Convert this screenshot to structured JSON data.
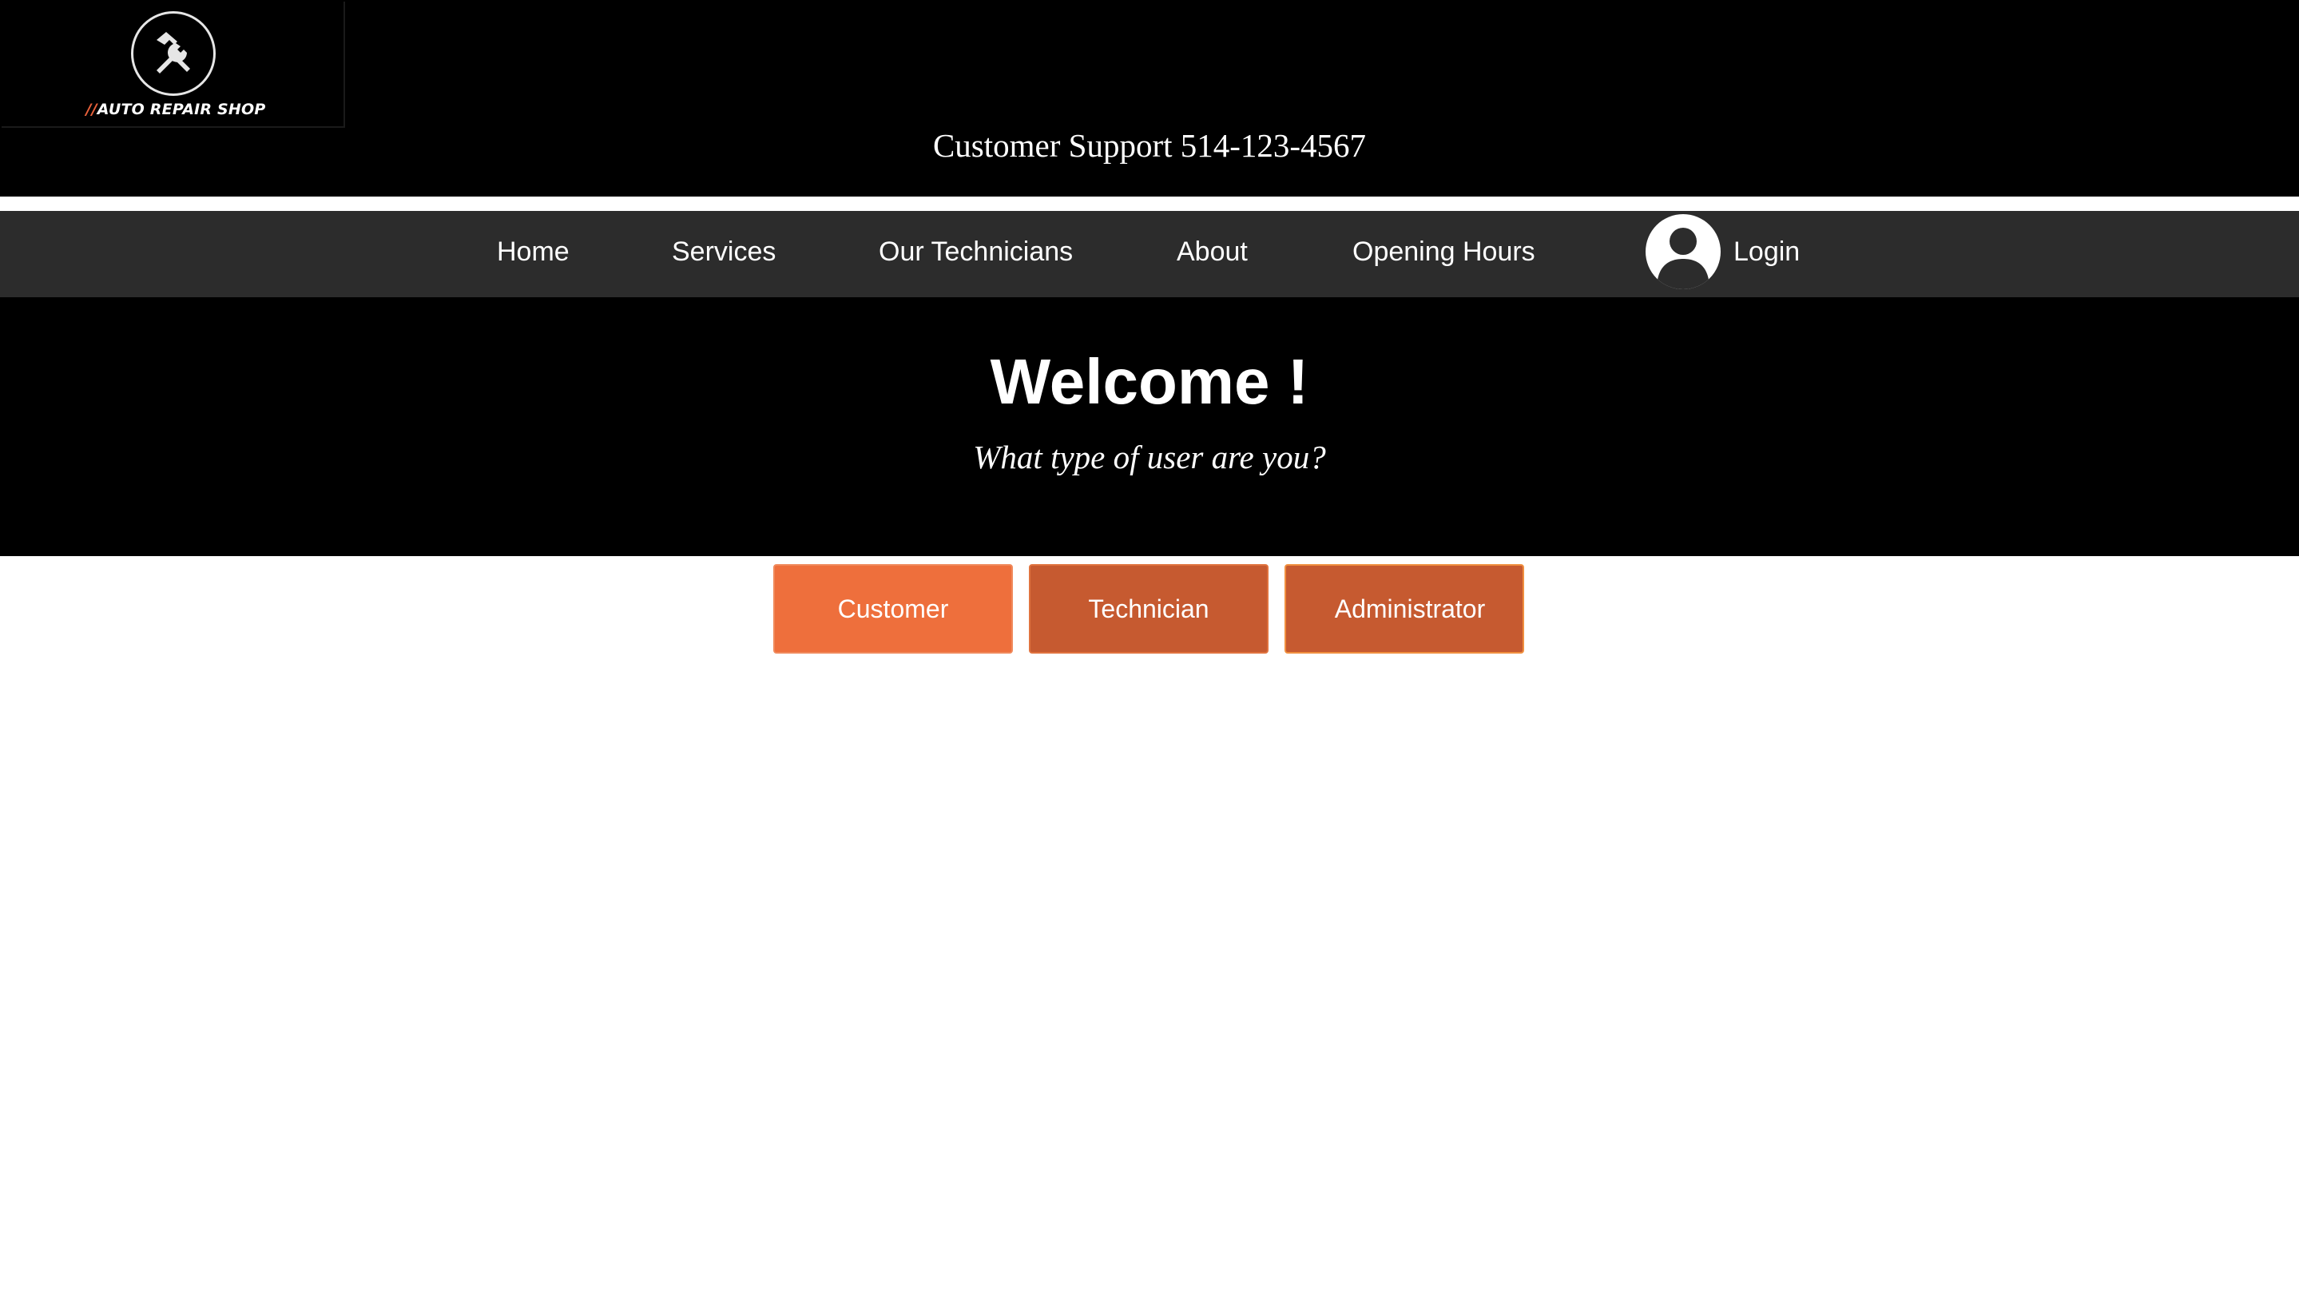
{
  "header": {
    "logo_text_prefix": "//",
    "logo_text": "AUTO REPAIR SHOP",
    "support_text": "Customer Support 514-123-4567"
  },
  "nav": {
    "items": [
      {
        "label": "Home"
      },
      {
        "label": "Services"
      },
      {
        "label": "Our Technicians"
      },
      {
        "label": "About"
      },
      {
        "label": "Opening Hours"
      }
    ],
    "login_label": "Login"
  },
  "hero": {
    "title": "Welcome !",
    "subtitle": "What type of user are you?"
  },
  "roles": {
    "customer": "Customer",
    "technician": "Technician",
    "administrator": "Administrator"
  },
  "colors": {
    "header_bg": "#000000",
    "nav_bg": "#2c2c2c",
    "accent_orange": "#ee6f3c",
    "accent_dark_orange": "#c65a30"
  },
  "icons": {
    "logo": "hammer-wrench-icon",
    "avatar": "user-avatar-icon"
  }
}
